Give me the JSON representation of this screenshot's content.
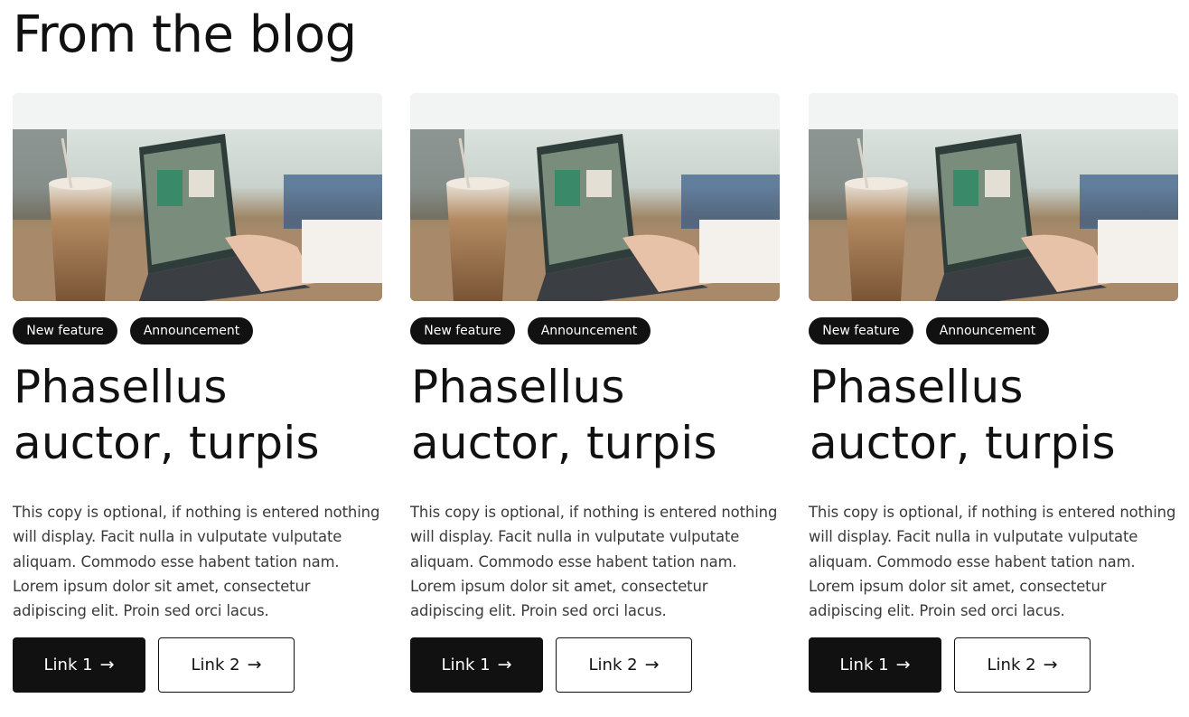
{
  "section": {
    "title": "From the blog"
  },
  "cards": [
    {
      "tags": [
        "New feature",
        "Announcement"
      ],
      "title": "Phasellus auctor, turpis",
      "copy": "This copy is optional, if nothing is entered nothing will display. Facit nulla in vulputate vulputate aliquam. Commodo esse habent tation nam. Lorem ipsum dolor sit amet, consectetur adipiscing elit. Proin sed orci lacus.",
      "link1": "Link 1",
      "link2": "Link 2",
      "image_icon": "laptop-photo-icon"
    },
    {
      "tags": [
        "New feature",
        "Announcement"
      ],
      "title": "Phasellus auctor, turpis",
      "copy": "This copy is optional, if nothing is entered nothing will display. Facit nulla in vulputate vulputate aliquam. Commodo esse habent tation nam. Lorem ipsum dolor sit amet, consectetur adipiscing elit. Proin sed orci lacus.",
      "link1": "Link 1",
      "link2": "Link 2",
      "image_icon": "laptop-photo-icon"
    },
    {
      "tags": [
        "New feature",
        "Announcement"
      ],
      "title": "Phasellus auctor, turpis",
      "copy": "This copy is optional, if nothing is entered nothing will display. Facit nulla in vulputate vulputate aliquam. Commodo esse habent tation nam. Lorem ipsum dolor sit amet, consectetur adipiscing elit. Proin sed orci lacus.",
      "link1": "Link 1",
      "link2": "Link 2",
      "image_icon": "laptop-photo-icon"
    }
  ],
  "icons": {
    "arrow": "→",
    "arrow_name": "arrow-right-icon"
  },
  "colors": {
    "primary": "#111111",
    "background": "#ffffff",
    "text_muted": "#3a3a3a"
  }
}
